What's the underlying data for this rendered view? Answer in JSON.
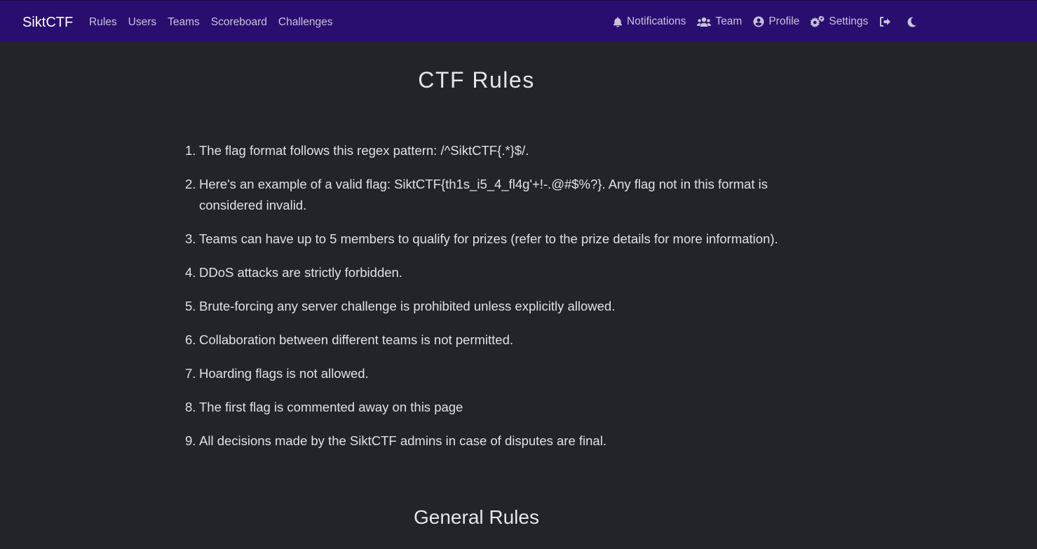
{
  "navbar": {
    "brand": "SiktCTF",
    "left_links": [
      "Rules",
      "Users",
      "Teams",
      "Scoreboard",
      "Challenges"
    ],
    "right_links": [
      {
        "label": "Notifications",
        "icon": "bell-icon"
      },
      {
        "label": "Team",
        "icon": "users-icon"
      },
      {
        "label": "Profile",
        "icon": "user-circle-icon"
      },
      {
        "label": "Settings",
        "icon": "gears-icon"
      }
    ],
    "logout_icon": "logout-icon",
    "theme_icon": "moon-icon",
    "background_color": "#2a0e6f"
  },
  "page": {
    "title": "CTF Rules",
    "rules": [
      {
        "num": "1.",
        "text": "The flag format follows this regex pattern: /^SiktCTF{.*}$/."
      },
      {
        "num": "2.",
        "text": "Here's an example of a valid flag: SiktCTF{th1s_i5_4_fl4g'+!-.@#$%?}. Any flag not in this format is considered invalid."
      },
      {
        "num": "3.",
        "text": "Teams can have up to 5 members to qualify for prizes (refer to the prize details for more information)."
      },
      {
        "num": "4.",
        "text": "DDoS attacks are strictly forbidden."
      },
      {
        "num": "5.",
        "text": "Brute-forcing any server challenge is prohibited unless explicitly allowed."
      },
      {
        "num": "6.",
        "text": "Collaboration between different teams is not permitted."
      },
      {
        "num": "7.",
        "text": "Hoarding flags is not allowed."
      },
      {
        "num": "8.",
        "text": "The first flag is commented away on this page"
      },
      {
        "num": "9.",
        "text": "All decisions made by the SiktCTF admins in case of disputes are final."
      }
    ],
    "section_title": "General Rules",
    "background_color": "#212529"
  }
}
